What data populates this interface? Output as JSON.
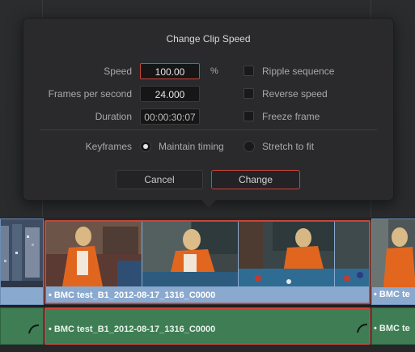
{
  "dialog": {
    "title": "Change Clip Speed",
    "speed_label": "Speed",
    "speed_value": "100.00",
    "speed_unit": "%",
    "fps_label": "Frames per second",
    "fps_value": "24.000",
    "duration_label": "Duration",
    "duration_value": "00:00:30:07",
    "options": [
      {
        "label": "Ripple sequence",
        "checked": false
      },
      {
        "label": "Reverse speed",
        "checked": false
      },
      {
        "label": "Freeze frame",
        "checked": false
      }
    ],
    "keyframes_label": "Keyframes",
    "keyframe_modes": [
      {
        "label": "Maintain timing",
        "selected": true
      },
      {
        "label": "Stretch to fit",
        "selected": false
      }
    ],
    "cancel_label": "Cancel",
    "change_label": "Change"
  },
  "timeline": {
    "video_clip_name": "• BMC test_B1_2012-08-17_1316_C0000",
    "audio_clip_name": "• BMC test_B1_2012-08-17_1316_C0000",
    "next_video_clip_name": "• BMC te",
    "next_audio_clip_name": "• BMC te",
    "colors": {
      "video_clip": "#8aa9cf",
      "audio_clip": "#3f7d55",
      "selection": "#c9453a"
    }
  }
}
